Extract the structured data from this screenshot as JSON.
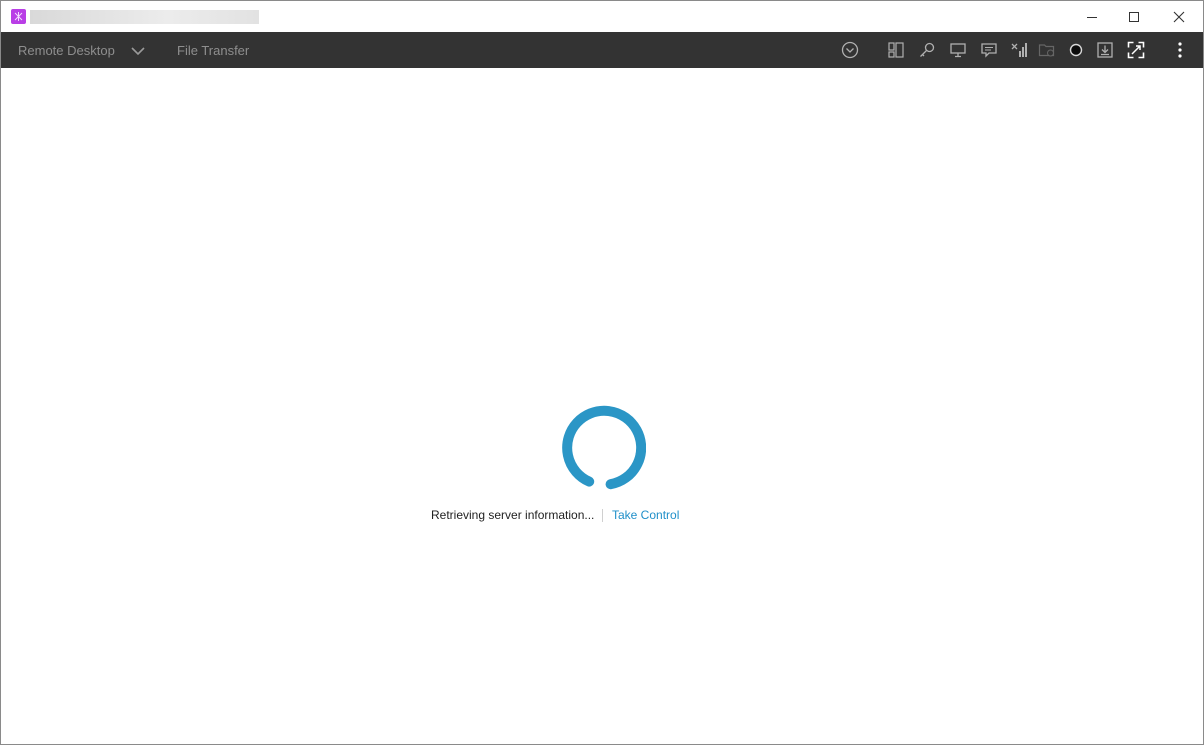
{
  "window": {
    "controls": [
      "minimize-icon",
      "maximize-icon",
      "close-icon"
    ]
  },
  "toolbar": {
    "tabs": [
      {
        "label": "Remote Desktop"
      },
      {
        "label": "File Transfer"
      }
    ],
    "icons": [
      "chevron-circle-icon",
      "layout-icon",
      "key-icon",
      "monitor-icon",
      "chat-icon",
      "signal-icon",
      "folder-icon",
      "record-icon",
      "download-icon",
      "fullscreen-icon",
      "more-icon"
    ]
  },
  "status": {
    "message": "Retrieving server information...",
    "action_label": "Take Control"
  },
  "colors": {
    "toolbar_bg": "#333333",
    "spinner": "#2b96c6",
    "link": "#1f8fc9",
    "app_icon": "#b93ee6"
  }
}
